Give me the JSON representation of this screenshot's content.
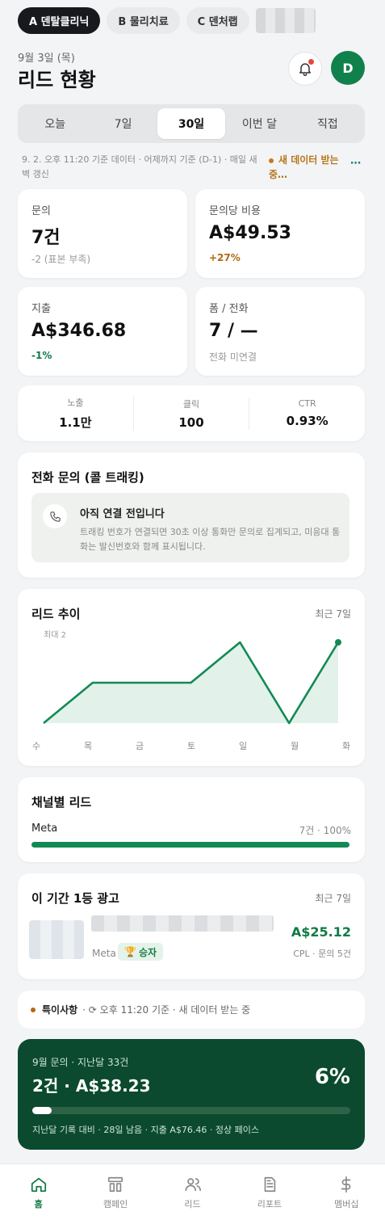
{
  "client_tabs": [
    {
      "label": "A 덴탈클리닉",
      "active": true
    },
    {
      "label": "B 물리치료",
      "active": false
    },
    {
      "label": "C 덴처랩",
      "active": false
    }
  ],
  "header": {
    "date": "9월 3일 (목)",
    "title": "리드 현황",
    "avatar_initial": "D"
  },
  "range_tabs": [
    "오늘",
    "7일",
    "30일",
    "이번 달",
    "직접"
  ],
  "range_active": "30일",
  "info": {
    "text": "9. 2. 오후 11:20 기준 데이터 · 어제까지 기준 (D-1) · 매일 새벽 갱신",
    "status": "새 데이터 받는 중…",
    "more": "⋯"
  },
  "metrics": [
    {
      "label": "문의",
      "value": "7건",
      "sub": "-2 (표본 부족)"
    },
    {
      "label": "문의당 비용",
      "value": "A$49.53",
      "sub": "+27%"
    },
    {
      "label": "지출",
      "value": "A$346.68",
      "sub": "-1%"
    },
    {
      "label": "폼 / 전화",
      "value": "7 / —",
      "sub": "전화 미연결"
    }
  ],
  "stats": [
    {
      "label": "노출",
      "value": "1.1만"
    },
    {
      "label": "클릭",
      "value": "100"
    },
    {
      "label": "CTR",
      "value": "0.93%"
    }
  ],
  "call_tracking": {
    "title": "전화 문의 (콜 트래킹)",
    "box_title": "아직 연결 전입니다",
    "box_desc": "트래킹 번호가 연결되면 30초 이상 통화만 문의로 집계되고, 미응대 통화는 발신번호와 함께 표시됩니다."
  },
  "trend": {
    "title": "리드 추이",
    "period": "최근 7일",
    "max_label": "최대 2"
  },
  "chart_data": {
    "type": "area",
    "categories": [
      "수",
      "목",
      "금",
      "토",
      "일",
      "월",
      "화"
    ],
    "values": [
      0,
      1,
      1,
      1,
      2,
      0,
      2
    ],
    "ylim": [
      0,
      2
    ],
    "color": "#128a55"
  },
  "channel": {
    "title": "채널별 리드",
    "name": "Meta",
    "value": "7건 · 100%",
    "share": 1.0
  },
  "top_ad": {
    "title": "이 기간 1등 광고",
    "period": "최근 7일",
    "platform": "Meta",
    "badge": "승자",
    "cpl": "A$25.12",
    "meta": "CPL · 문의 5건"
  },
  "note": {
    "title": "특이사항",
    "text": "· ⟳ 오후 11:20 기준 · 새 데이터 받는 중"
  },
  "pace": {
    "label": "9월 문의 · 지난달 33건",
    "value": "2건 · A$38.23",
    "percent": "6%",
    "progress": 0.06,
    "detail": "지난달 기록 대비 · 28일 남음 · 지출 A$76.46 · 정상 페이스"
  },
  "nav": [
    {
      "label": "홈",
      "icon": "home-icon",
      "active": true
    },
    {
      "label": "캠페인",
      "icon": "campaign-icon",
      "active": false
    },
    {
      "label": "리드",
      "icon": "users-icon",
      "active": false
    },
    {
      "label": "리포트",
      "icon": "report-icon",
      "active": false
    },
    {
      "label": "멤버십",
      "icon": "dollar-icon",
      "active": false
    }
  ]
}
